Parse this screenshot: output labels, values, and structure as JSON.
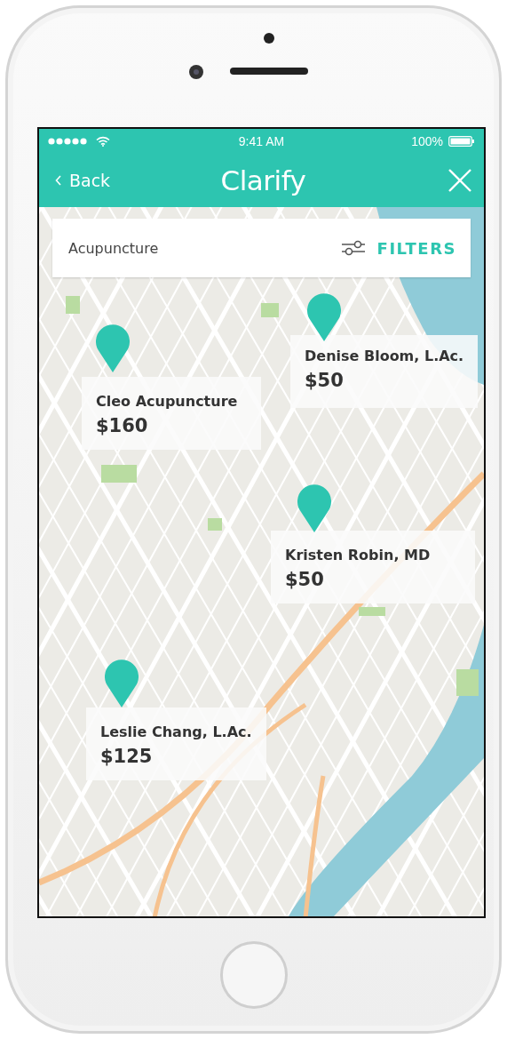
{
  "status_bar": {
    "time": "9:41 AM",
    "battery": "100%"
  },
  "nav_bar": {
    "back": "Back",
    "title": "Clarify"
  },
  "search": {
    "value": "Acupuncture",
    "filters": "FILTERS"
  },
  "listings": [
    {
      "name": "Cleo Acupuncture",
      "price": "$160"
    },
    {
      "name": "Denise Bloom, L.Ac.",
      "price": "$50"
    },
    {
      "name": "Kristen Robin, MD",
      "price": "$50"
    },
    {
      "name": "Leslie Chang, L.Ac.",
      "price": "$125"
    }
  ]
}
